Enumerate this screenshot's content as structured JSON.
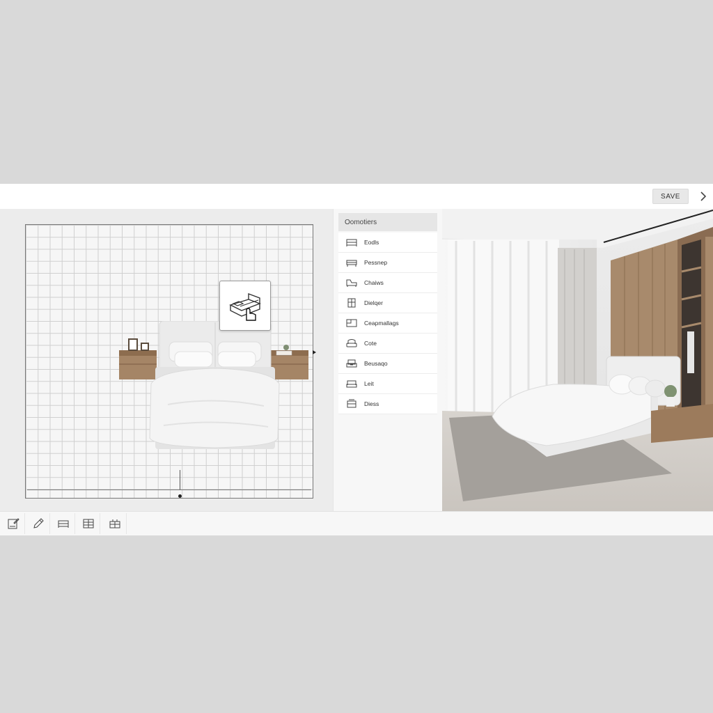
{
  "header": {
    "save_label": "SAVE",
    "next_icon": "chevron-right-icon"
  },
  "canvas": {
    "hover_item_icon": "bed-drag-icon"
  },
  "catalog": {
    "title": "Oomotiers",
    "items": [
      {
        "label": "Eodls",
        "icon": "bed-icon"
      },
      {
        "label": "Pessnep",
        "icon": "bench-icon"
      },
      {
        "label": "Chaiws",
        "icon": "chaise-icon"
      },
      {
        "label": "Dielqer",
        "icon": "wardrobe-icon"
      },
      {
        "label": "Ceapmallags",
        "icon": "desk-icon"
      },
      {
        "label": "Cote",
        "icon": "armchair-icon"
      },
      {
        "label": "Beusaqo",
        "icon": "sofa-chair-icon"
      },
      {
        "label": "Leit",
        "icon": "loveseat-icon"
      },
      {
        "label": "Diess",
        "icon": "dresser-icon"
      }
    ]
  },
  "toolbar": {
    "tools": [
      "floor-plan-icon",
      "pencil-icon",
      "bed-tool-icon",
      "shelving-icon",
      "cabinet-icon"
    ]
  },
  "colors": {
    "accent": "#e8e8e8",
    "wood": "#a58566",
    "background": "#d9d9d9"
  }
}
